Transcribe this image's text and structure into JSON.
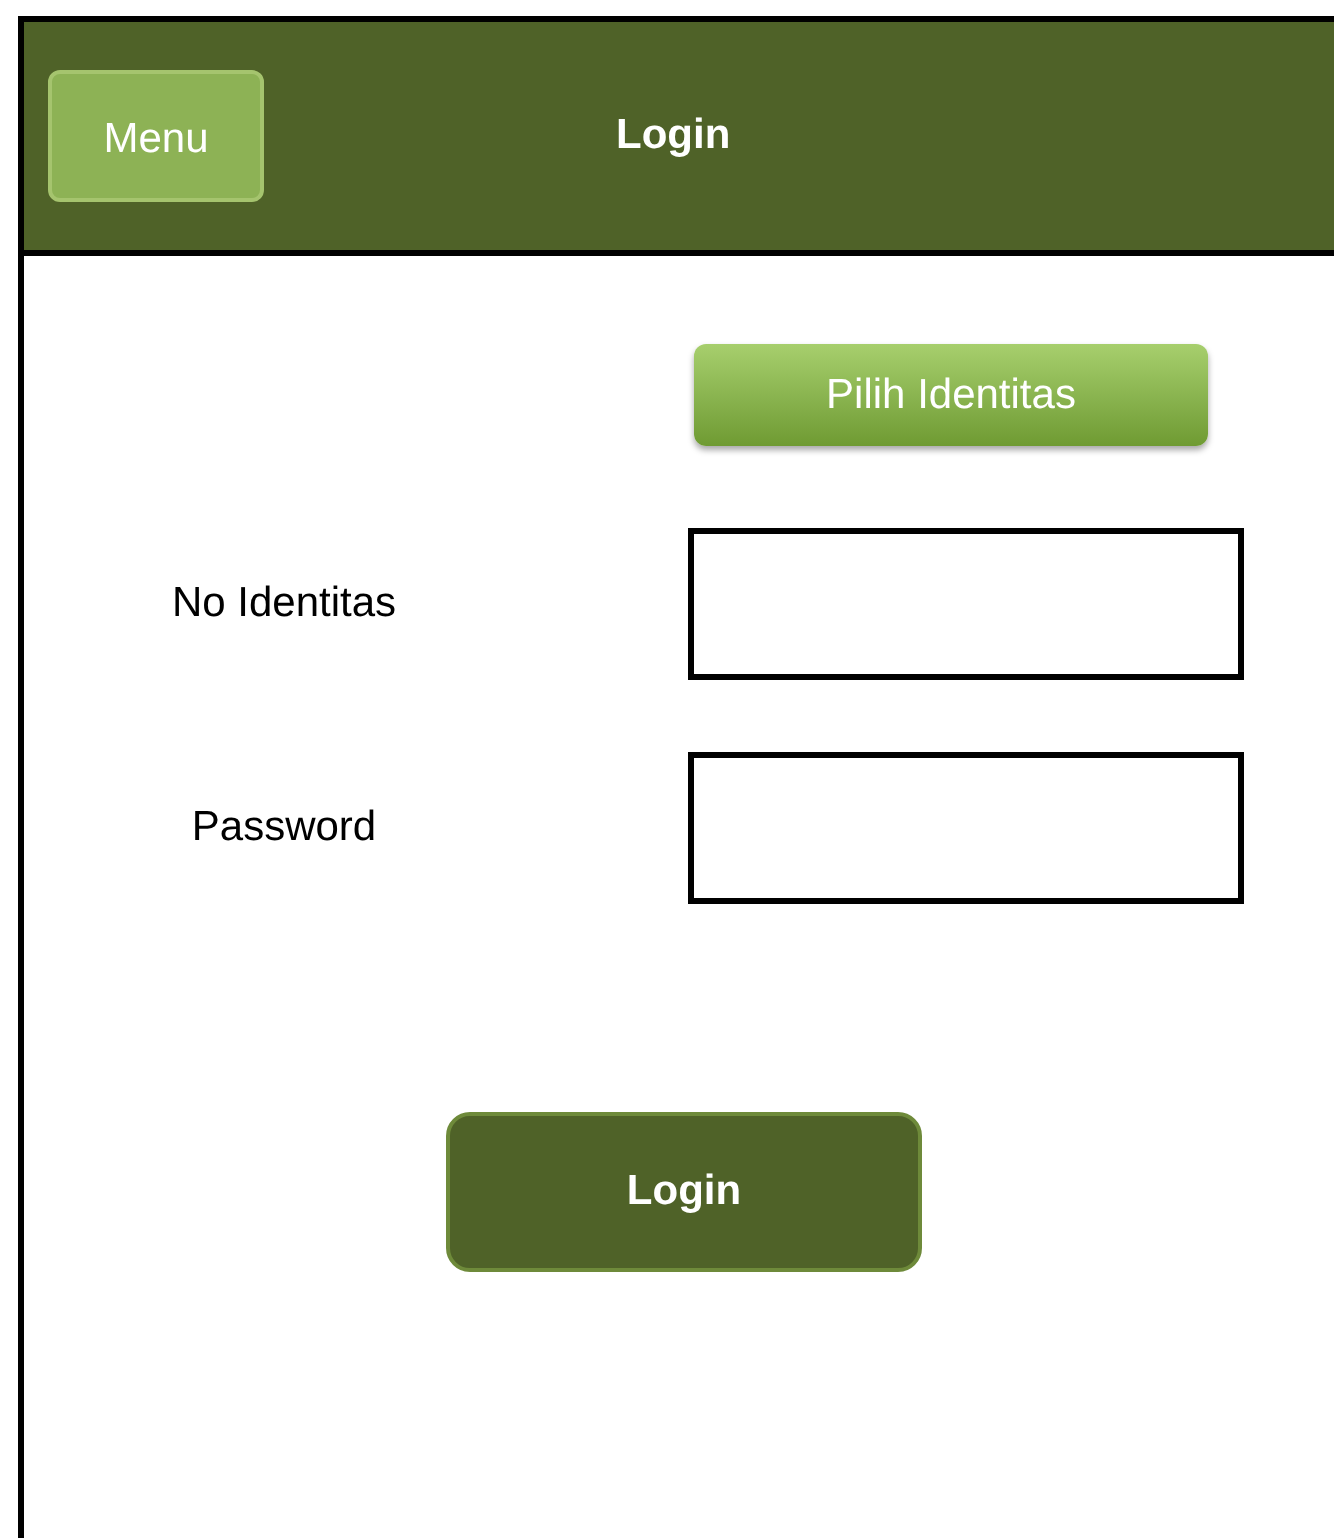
{
  "header": {
    "menu_button": "Menu",
    "title": "Login"
  },
  "choose_identity_button": "Pilih Identitas",
  "fields": [
    {
      "label": "No Identitas"
    },
    {
      "label": "Password"
    }
  ],
  "login_button": "Login"
}
